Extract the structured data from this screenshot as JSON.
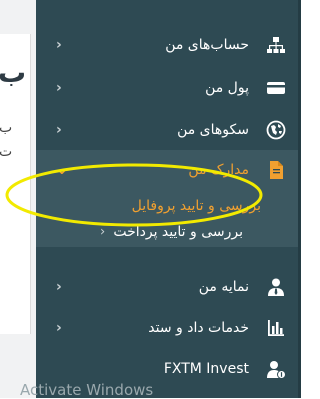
{
  "left_page": {
    "heading": "ب",
    "line1": "ب",
    "line2": "ت"
  },
  "menu": [
    {
      "label": "حساب‌های من",
      "icon": "sitemap-icon"
    },
    {
      "label": "پول من",
      "icon": "credit-card-icon"
    },
    {
      "label": "سکوهای من",
      "icon": "globe-icon"
    },
    {
      "label": "مدارک من",
      "icon": "document-icon"
    },
    {
      "label": "نمایه من",
      "icon": "user-tie-icon"
    },
    {
      "label": "خدمات داد و ستد",
      "icon": "bar-chart-icon"
    },
    {
      "label": "FXTM Invest",
      "icon": "user-investor-icon"
    }
  ],
  "submenu": [
    {
      "label": "بررسی و تایید پروفایل"
    },
    {
      "label": "بررسی و تایید پرداخت"
    }
  ],
  "chevron": "›",
  "chevron_active": "⌄",
  "watermark": "Activate Windows",
  "colors": {
    "sidebar": "#2e4a53",
    "active": "#f0a030",
    "highlight": "#f2ea00"
  }
}
